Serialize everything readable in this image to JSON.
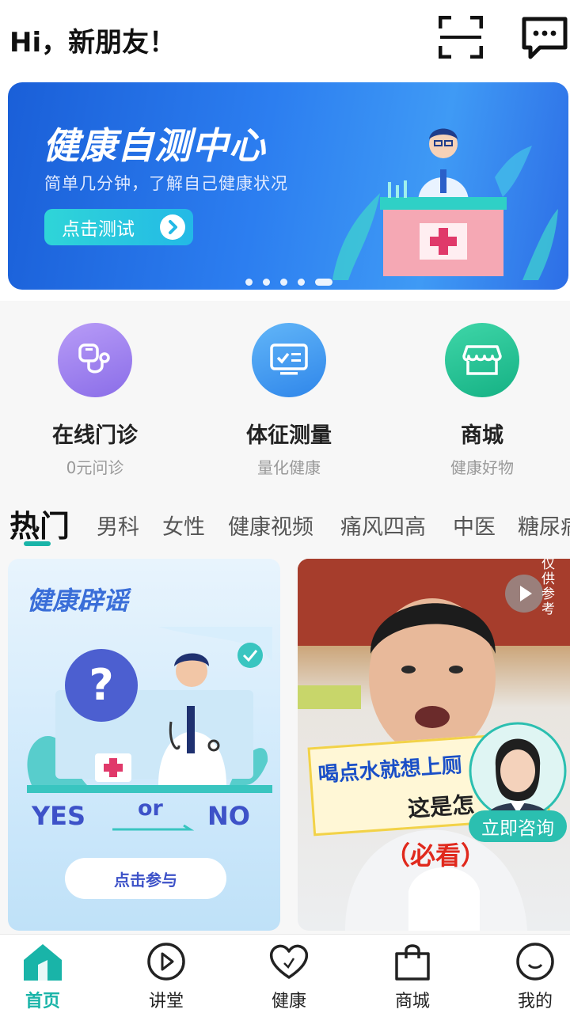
{
  "header": {
    "greeting": "Hi，新朋友！",
    "scan_icon": "scan-icon",
    "message_icon": "message-icon"
  },
  "banner": {
    "title": "健康自测中心",
    "subtitle": "简单几分钟，了解自己健康状况",
    "button_label": "点击测试",
    "slide_count": 5,
    "active_slide": 5
  },
  "shortcuts": [
    {
      "title": "在线门诊",
      "subtitle": "0元问诊",
      "icon": "stethoscope-icon",
      "color": "#9d7ef0"
    },
    {
      "title": "体征测量",
      "subtitle": "量化健康",
      "icon": "monitor-icon",
      "color": "#3a98ef"
    },
    {
      "title": "商城",
      "subtitle": "健康好物",
      "icon": "store-icon",
      "color": "#1fbf93"
    }
  ],
  "tabs": [
    "热门",
    "男科",
    "女性",
    "健康视频",
    "痛风四高",
    "中医",
    "糖尿病"
  ],
  "cards": {
    "myth": {
      "title": "健康辟谣",
      "yes": "YES",
      "or": "or",
      "no": "NO",
      "button_label": "点击参与"
    },
    "video": {
      "caption_line1": "喝点水就想上厕",
      "caption_line2": "这是怎",
      "tag": "（必看）",
      "side_note": "仅供参考",
      "consult_label": "立即咨询"
    }
  },
  "bottom_nav": [
    {
      "label": "首页",
      "icon": "home-icon",
      "active": true
    },
    {
      "label": "讲堂",
      "icon": "play-circle-icon",
      "active": false
    },
    {
      "label": "健康",
      "icon": "heart-icon",
      "active": false
    },
    {
      "label": "商城",
      "icon": "shopping-bag-icon",
      "active": false
    },
    {
      "label": "我的",
      "icon": "profile-icon",
      "active": false
    }
  ],
  "colors": {
    "accent": "#19b4a8",
    "banner_blue": "#2c7ef0"
  }
}
